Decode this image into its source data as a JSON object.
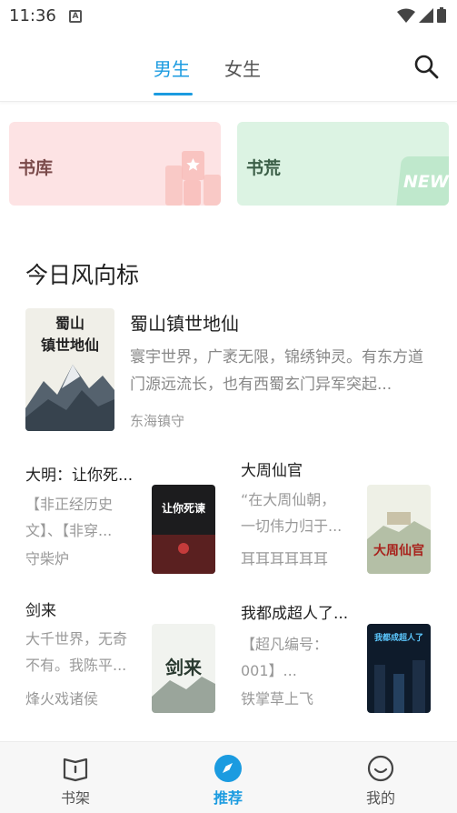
{
  "status_bar": {
    "time": "11:36",
    "notification_letter": "A"
  },
  "header": {
    "tabs": [
      {
        "label": "男生",
        "active": true
      },
      {
        "label": "女生",
        "active": false
      }
    ],
    "search_icon": "search-icon",
    "accent_color": "#1b9be0"
  },
  "quick_cards": [
    {
      "label": "书库",
      "badge": "",
      "color": "#fde3e4"
    },
    {
      "label": "书荒",
      "badge": "NEW",
      "color": "#dcf3e3"
    }
  ],
  "section": {
    "title": "今日风向标",
    "featured": {
      "title": "蜀山镇世地仙",
      "description": "寰宇世界，广袤无限，锦绣钟灵。有东方道门源远流长，也有西蜀玄门异军突起...",
      "author": "东海镇守",
      "cover_text": "蜀山镇世地仙"
    },
    "books": [
      {
        "title": "大明：让你死...",
        "description": "【非正经历史文】、【非穿...",
        "author": "守柴炉",
        "cover_text": "让你死谏"
      },
      {
        "title": "大周仙官",
        "description": "“在大周仙朝，一切伟力归于...",
        "author": "耳耳耳耳耳耳",
        "cover_text": "大周仙官"
      },
      {
        "title": "剑来",
        "description": "大千世界，无奇不有。我陈平...",
        "author": "烽火戏诸侯",
        "cover_text": "剑来"
      },
      {
        "title": "我都成超人了...",
        "description": "【超凡编号：001】...",
        "author": "铁掌草上飞",
        "cover_text": "我都成超人了"
      }
    ]
  },
  "bottom_nav": [
    {
      "label": "书架",
      "icon": "bookshelf-icon",
      "active": false
    },
    {
      "label": "推荐",
      "icon": "compass-icon",
      "active": true
    },
    {
      "label": "我的",
      "icon": "smiley-icon",
      "active": false
    }
  ]
}
